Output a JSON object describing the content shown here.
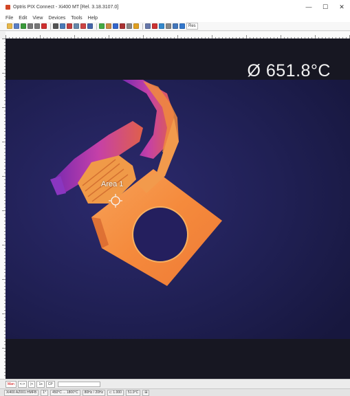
{
  "window": {
    "title": "Optris PIX Connect - Xi400 MT [Rel. 3.18.3107.0]",
    "minimize": "—",
    "maximize": "☐",
    "close": "✕"
  },
  "menu": [
    "File",
    "Edit",
    "View",
    "Devices",
    "Tools",
    "Help"
  ],
  "toolbar": {
    "buttons": [
      {
        "name": "open-icon",
        "color": "#e8b84a"
      },
      {
        "name": "save-icon",
        "color": "#5b7fc7"
      },
      {
        "name": "play-icon",
        "color": "#3a9a3a"
      },
      {
        "name": "pause-icon",
        "color": "#777777"
      },
      {
        "name": "stop-icon",
        "color": "#777777"
      },
      {
        "name": "record-icon",
        "color": "#d03030"
      },
      {
        "name": "snapshot-icon",
        "color": "#555555"
      },
      {
        "name": "camera-icon",
        "color": "#4a7ab8"
      },
      {
        "name": "layout-icon",
        "color": "#c04040"
      },
      {
        "name": "grid-icon",
        "color": "#6688aa"
      },
      {
        "name": "graph-icon",
        "color": "#cc4444"
      },
      {
        "name": "histogram-icon",
        "color": "#4466aa"
      },
      {
        "name": "profile-icon",
        "color": "#44aa44"
      },
      {
        "name": "line-icon",
        "color": "#cc8844"
      },
      {
        "name": "flag-icon",
        "color": "#3366cc"
      },
      {
        "name": "chart-icon",
        "color": "#aa3333"
      },
      {
        "name": "settings-icon",
        "color": "#888888"
      },
      {
        "name": "palette-icon",
        "color": "#e0a020"
      },
      {
        "name": "measure-icon",
        "color": "#6677aa"
      },
      {
        "name": "target-icon",
        "color": "#cc3333"
      },
      {
        "name": "image-icon",
        "color": "#3388cc"
      },
      {
        "name": "export-icon",
        "color": "#888888"
      },
      {
        "name": "zoom-icon",
        "color": "#4477bb"
      },
      {
        "name": "info-icon",
        "color": "#3377cc"
      }
    ],
    "text_button": "Res"
  },
  "thermal": {
    "avg_temperature": "Ø 651.8°C",
    "area_label": "Area 1"
  },
  "bottom_controls": {
    "buttons": [
      "Man",
      "<-> ",
      "|<",
      "1s",
      "CP"
    ]
  },
  "status": [
    "Xi400 AZ001 HMFB",
    "1°",
    "450°C ... 1800°C",
    "80Hz / 20Hz",
    "c: 1.000",
    "51.9°C",
    "⊞"
  ]
}
